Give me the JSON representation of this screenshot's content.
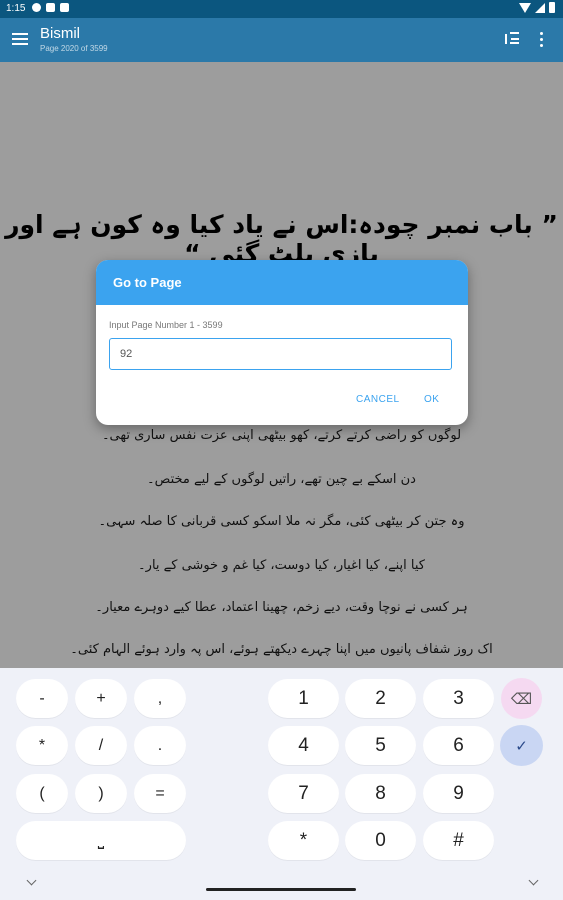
{
  "status_bar": {
    "time": "1:15"
  },
  "app_bar": {
    "title": "Bismil",
    "subtitle": "Page 2020 of 3599"
  },
  "book": {
    "chapter_title": "” باب نمبر چودہ:اس نے یاد کیا وہ کون ہے اور بازی پلٹ گئی “",
    "paragraphs": [
      "لوگوں کو راضی کرتے کرتے، کھو بیٹھی اپنی عزت نفس ساری تھی۔",
      "دن اسکے بے چین تھے، راتیں لوگوں کے لیے مختص۔",
      "وہ جتن کر بیٹھی کئی، مگر نہ ملا اسکو کسی قربانی کا صلہ سہی۔",
      "کیا اپنے، کیا اغیار، کیا دوست، کیا غم و خوشی کے یار۔",
      "ہر کسی نے نوچا وقت، دیے زخم، چھینا اعتماد، عطا کیے دوہرے معیار۔",
      "اک روز شفاف پانیوں میں اپنا چہرے دیکھتے ہوئے، اس پہ وارد ہوئے الہام کئی۔"
    ]
  },
  "dialog": {
    "title": "Go to Page",
    "label": "Input Page Number 1 - 3599",
    "input_value": "92",
    "cancel_label": "CANCEL",
    "ok_label": "OK"
  },
  "keyboard": {
    "symbol_rows": [
      [
        "-",
        "+",
        ","
      ],
      [
        "*",
        "/",
        "."
      ],
      [
        "(",
        ")",
        "="
      ]
    ],
    "digit_rows": [
      [
        "1",
        "2",
        "3"
      ],
      [
        "4",
        "5",
        "6"
      ],
      [
        "7",
        "8",
        "9"
      ],
      [
        "*",
        "0",
        "#"
      ]
    ],
    "space_label": "⎵",
    "backspace_icon": "⌫",
    "done_icon": "✓"
  }
}
